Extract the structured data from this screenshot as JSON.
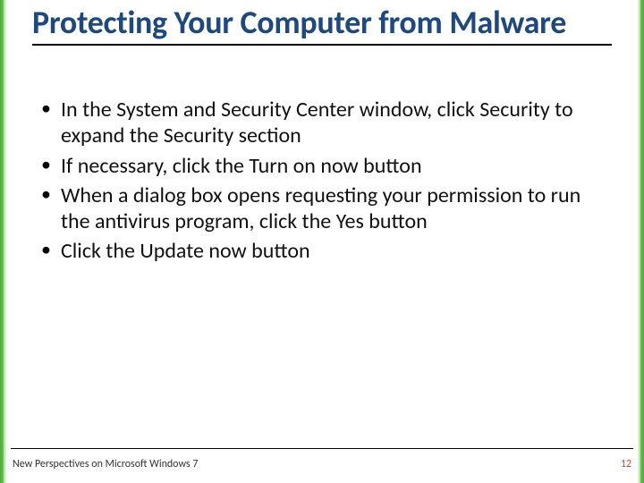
{
  "title": "Protecting Your Computer from Malware",
  "bullets": [
    "In the System and Security Center window, click Security to expand the Security section",
    "If necessary, click the Turn on now button",
    "When a dialog box opens requesting your permission to run the antivirus program, click the Yes button",
    "Click the Update now button"
  ],
  "footer": {
    "left": "New Perspectives on Microsoft Windows 7",
    "page": "12"
  },
  "colors": {
    "title": "#1f497d",
    "accent_green": "#4fa83a",
    "page_number": "#d14a2f"
  }
}
